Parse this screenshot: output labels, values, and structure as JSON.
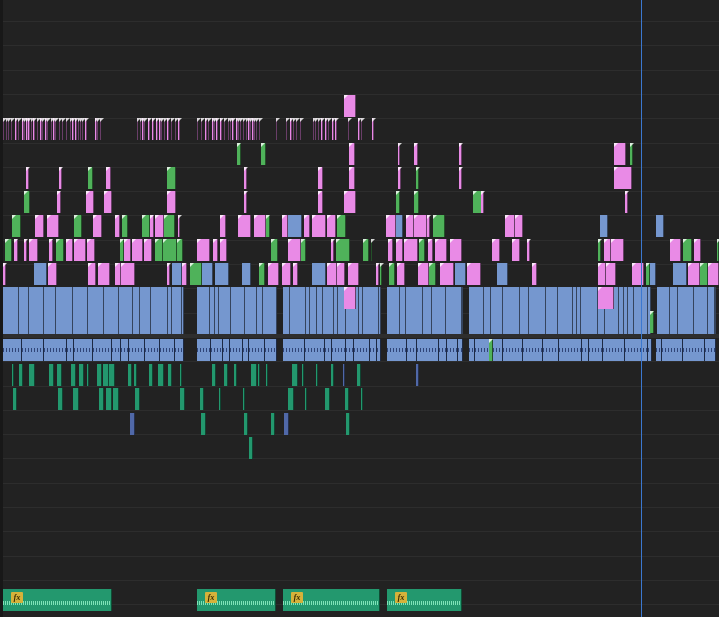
{
  "timeline": {
    "playhead_color": "#3b78d0",
    "track_colors": {
      "video_clip_pink": "#e98ae6",
      "video_clip_green": "#4fb25a",
      "audio_clip_blue": "#7597cf",
      "sound_clip_teal": "#23986e"
    },
    "effect_badge_icon": "fx-icon",
    "effect_badge_label": "fx"
  }
}
